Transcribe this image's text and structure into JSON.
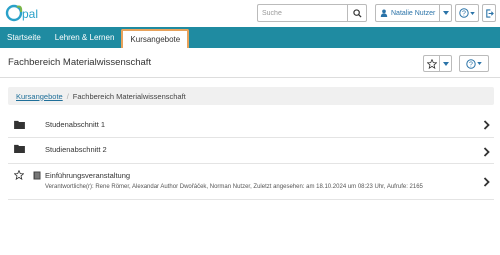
{
  "app": {
    "logo_text": "Opal"
  },
  "topbar": {
    "search_placeholder": "Suche",
    "user_name": "Natalie Nutzer"
  },
  "nav": {
    "tabs": [
      {
        "label": "Startseite"
      },
      {
        "label": "Lehren & Lernen"
      },
      {
        "label": "Kursangebote",
        "active": true
      }
    ]
  },
  "header": {
    "title": "Fachbereich Materialwissenschaft"
  },
  "breadcrumb": {
    "link": "Kursangebote",
    "separator": "/",
    "current": "Fachbereich Materialwissenschaft"
  },
  "list": {
    "items": [
      {
        "label": "Studenabschnitt 1",
        "icon": "folder-icon"
      },
      {
        "label": "Studienabschnitt 2",
        "icon": "folder-icon"
      }
    ],
    "course": {
      "title": "Einführungsveranstaltung",
      "meta": "Verantwortliche(r): Rene Römer, Alexandar Author Dwořáček, Norman Nutzer, Zuletzt angesehen: am 18.10.2024 um 08:23 Uhr, Aufrufe: 2165",
      "icon": "book-icon"
    }
  },
  "colors": {
    "nav_bg": "#1f8ba1",
    "active_tab_border": "#e8a25b",
    "link": "#1f6f99"
  }
}
